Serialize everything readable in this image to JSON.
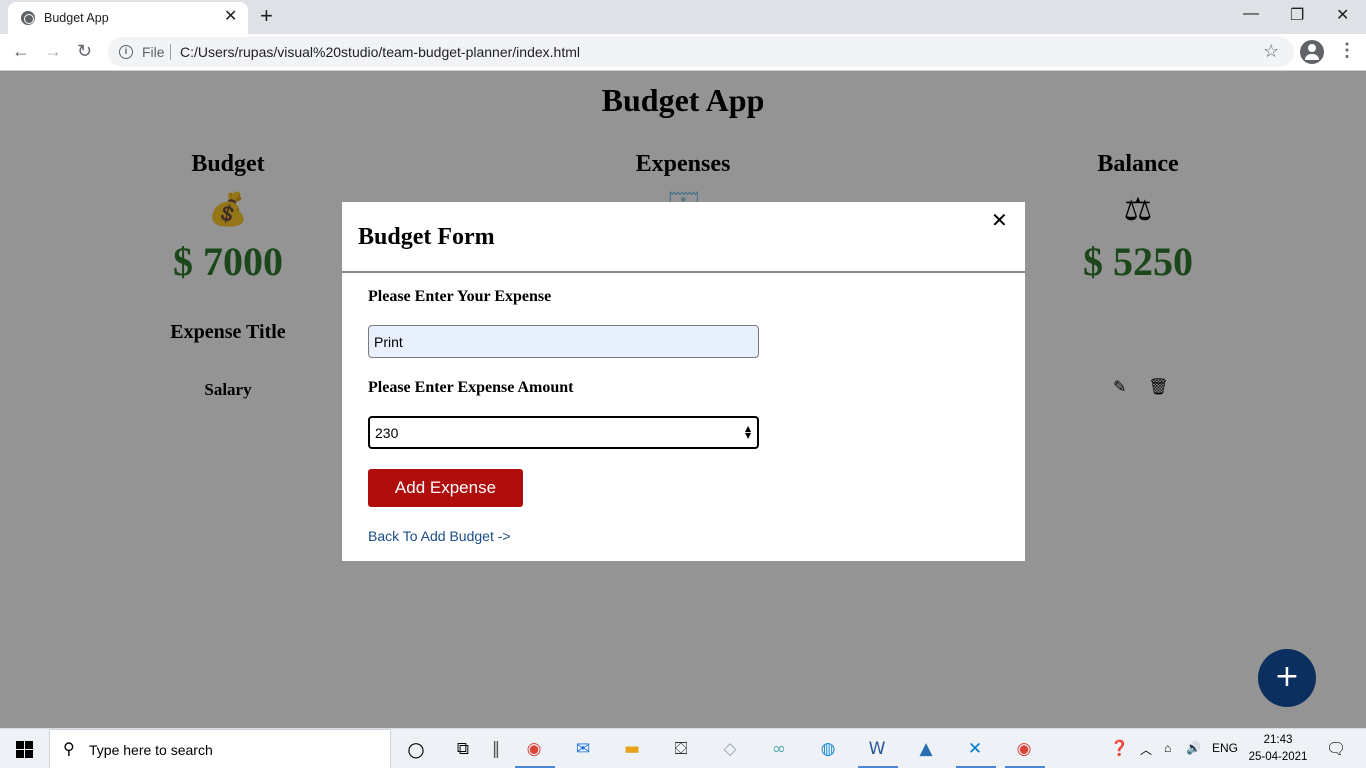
{
  "browser": {
    "tab_title": "Budget App",
    "file_label": "File",
    "url": "C:/Users/rupas/visual%20studio/team-budget-planner/index.html"
  },
  "app": {
    "title": "Budget App",
    "budget": {
      "label": "Budget",
      "amount": "$ 7000",
      "icon": "money-bag-icon"
    },
    "expenses": {
      "label": "Expenses",
      "icon": "receipt-icon"
    },
    "balance": {
      "label": "Balance",
      "amount": "$ 5250",
      "icon": "scale-icon"
    },
    "expense_list": {
      "header": "Expense Title",
      "rows": [
        {
          "title": "Salary"
        }
      ]
    }
  },
  "modal": {
    "title": "Budget Form",
    "expense_label": "Please Enter Your Expense",
    "expense_value": "Print",
    "amount_label": "Please Enter Expense Amount",
    "amount_value": "230",
    "submit_label": "Add Expense",
    "back_link": "Back To Add Budget ->"
  },
  "fab": {
    "label": "+"
  },
  "taskbar": {
    "search_placeholder": "Type here to search",
    "language": "ENG",
    "time": "21:43",
    "date": "25-04-2021"
  },
  "colors": {
    "money_green": "#2f7a2f",
    "button_red": "#b00d0d",
    "fab_navy": "#0b2f5e",
    "input_autofill": "#e8f0fe"
  }
}
